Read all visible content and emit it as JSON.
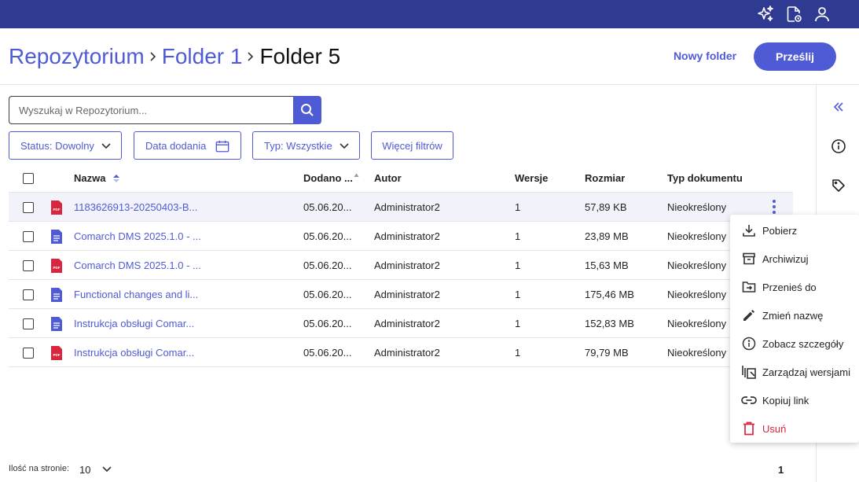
{
  "topbar": {
    "icons": [
      "sparkles-icon",
      "document-settings-icon",
      "user-icon"
    ]
  },
  "breadcrumb": {
    "items": [
      "Repozytorium",
      "Folder 1"
    ],
    "current": "Folder 5"
  },
  "header": {
    "new_folder_label": "Nowy folder",
    "upload_label": "Prześlij"
  },
  "search": {
    "placeholder": "Wyszukaj w Repozytorium...",
    "value": ""
  },
  "filters": {
    "status": "Status: Dowolny",
    "date": "Data dodania",
    "type": "Typ: Wszystkie",
    "more": "Więcej filtrów"
  },
  "table": {
    "columns": [
      "Nazwa",
      "Dodano ...",
      "Autor",
      "Wersje",
      "Rozmiar",
      "Typ dokumentu"
    ],
    "rows": [
      {
        "icon": "pdf-file-icon",
        "name": "1183626913-20250403-B...",
        "added": "05.06.20...",
        "author": "Administrator2",
        "versions": "1",
        "size": "57,89 KB",
        "doc_type": "Nieokreślony"
      },
      {
        "icon": "doc-file-icon",
        "name": "Comarch DMS 2025.1.0 - ...",
        "added": "05.06.20...",
        "author": "Administrator2",
        "versions": "1",
        "size": "23,89 MB",
        "doc_type": "Nieokreślony"
      },
      {
        "icon": "pdf-file-icon",
        "name": "Comarch DMS 2025.1.0 - ...",
        "added": "05.06.20...",
        "author": "Administrator2",
        "versions": "1",
        "size": "15,63 MB",
        "doc_type": "Nieokreślony"
      },
      {
        "icon": "doc-file-icon",
        "name": "Functional changes and li...",
        "added": "05.06.20...",
        "author": "Administrator2",
        "versions": "1",
        "size": "175,46 MB",
        "doc_type": "Nieokreślony"
      },
      {
        "icon": "doc-file-icon",
        "name": "Instrukcja obsługi Comar...",
        "added": "05.06.20...",
        "author": "Administrator2",
        "versions": "1",
        "size": "152,83 MB",
        "doc_type": "Nieokreślony"
      },
      {
        "icon": "pdf-file-icon",
        "name": "Instrukcja obsługi Comar...",
        "added": "05.06.20...",
        "author": "Administrator2",
        "versions": "1",
        "size": "79,79 MB",
        "doc_type": "Nieokreślony"
      }
    ]
  },
  "context_menu": {
    "items": [
      {
        "label": "Pobierz",
        "icon": "download-icon"
      },
      {
        "label": "Archiwizuj",
        "icon": "archive-icon"
      },
      {
        "label": "Przenieś do",
        "icon": "move-to-folder-icon"
      },
      {
        "label": "Zmień nazwę",
        "icon": "pencil-icon"
      },
      {
        "label": "Zobacz szczegóły",
        "icon": "info-icon"
      },
      {
        "label": "Zarządzaj wersjami",
        "icon": "versions-icon"
      },
      {
        "label": "Kopiuj link",
        "icon": "link-icon"
      },
      {
        "label": "Usuń",
        "icon": "trash-icon"
      }
    ]
  },
  "footer": {
    "per_page_label": "Ilość na stronie:",
    "per_page_value": "10",
    "current_page": "1"
  },
  "colors": {
    "topbar": "#2f3a93",
    "accent": "#4f5bd5",
    "danger": "#d7263d",
    "pdf": "#d7263d"
  }
}
